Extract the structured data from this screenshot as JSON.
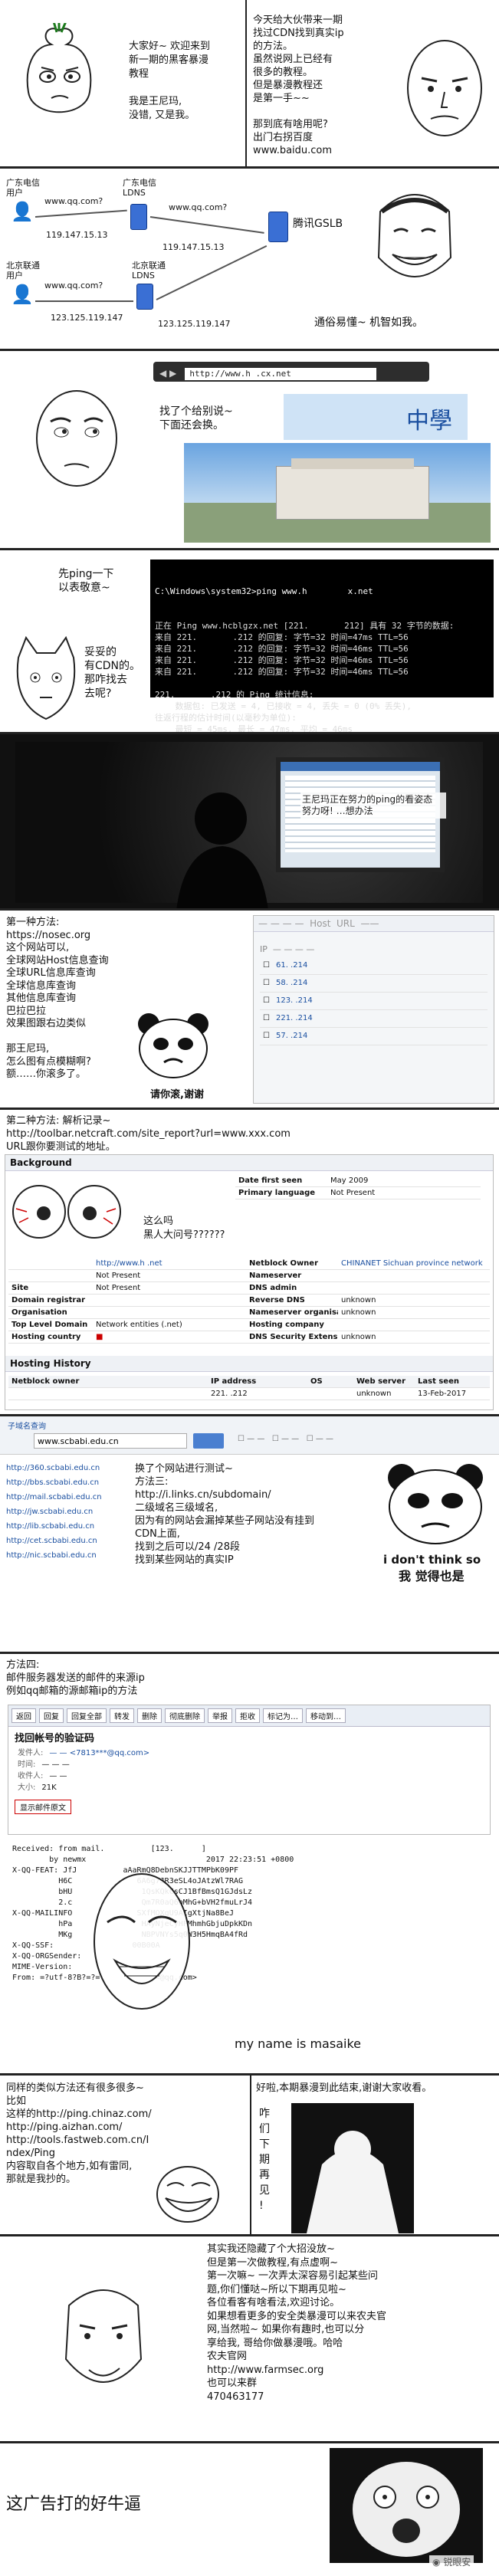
{
  "p1": {
    "bubble_left": "大家好~  欢迎来到\n新一期的黑客暴漫\n教程\n\n我是王尼玛,\n没错, 又是我。",
    "bubble_right": "今天给大伙带来一期\n找过CDN找到真实ip\n的方法。\n虽然说网上已经有\n很多的教程。\n但是暴漫教程还\n是第一手~~\n\n那到底有啥用呢?\n出门右拐百度\nwww.baidu.com"
  },
  "p2": {
    "gd_user": "广东电信\n用户",
    "gd_ldns": "广东电信\nLDNS",
    "bj_user": "北京联通\n用户",
    "bj_ldns": "北京联通\nLDNS",
    "gslb": "腾讯GSLB",
    "query1": "www.qq.com?",
    "query2": "www.qq.com?",
    "ip1": "119.147.15.13",
    "ip2": "119.147.15.13",
    "ip3": "123.125.119.147",
    "ip4": "123.125.119.147",
    "bubble": "通俗易懂~ 机智如我。"
  },
  "p3": {
    "address": "http://www.h           .cx.net",
    "bubble": "找了个给别说~\n下面还会换。",
    "banner": "中學"
  },
  "p4": {
    "bubble_top": "先ping一下\n以表敬意~",
    "bubble_bottom": "妥妥的\n有CDN的。\n那咋找去\n去呢?",
    "cmd_title": "C:\\Windows\\system32>ping www.h        x.net",
    "cmd_lines": [
      "正在 Ping www.hcblgzx.net [221.       212] 具有 32 字节的数据:",
      "来自 221.       .212 的回复: 字节=32 时间=47ms TTL=56",
      "来自 221.       .212 的回复: 字节=32 时间=46ms TTL=56",
      "来自 221.       .212 的回复: 字节=32 时间=46ms TTL=56",
      "来自 221.       .212 的回复: 字节=32 时间=46ms TTL=56",
      "",
      "221.       .212 的 Ping 统计信息:",
      "    数据包: 已发送 = 4, 已接收 = 4, 丢失 = 0 (0% 丢失),",
      "往返行程的估计时间(以毫秒为单位):",
      "    最短 = 45ms, 最长 = 47ms, 平均 = 46ms"
    ]
  },
  "p5": {
    "bubble": "王尼玛正在努力的ping的看姿态\n努力呀!  …想办法"
  },
  "p6": {
    "text": "第一种方法:\nhttps://nosec.org\n这个网站可以,\n全球网站Host信息查询\n全球URL信息库查询\n全球信息库查询\n其他信息库查询\n巴拉巴拉\n效果图跟右边类似\n\n那王尼玛,\n怎么图有点模糊啊?\n额……你滚多了。",
    "panda_caption": "请你滚,谢谢",
    "rows": [
      "61.       .214",
      "58.       .214",
      "123.       .214",
      "221.       .214",
      "57.       .214"
    ]
  },
  "p7": {
    "text": "第二种方法: 解析记录~\nhttp://toolbar.netcraft.com/site_report?url=www.xxx.com\nURL跟你要测试的地址。",
    "bg_title": "Background",
    "bubble": "这么吗\n黑人大问号??????",
    "date_label": "Date first seen",
    "date_value": "May 2009",
    "lang_label": "Primary language",
    "lang_value": "Not Present",
    "site": "http://www.h       .net",
    "owner_label": "Netblock Owner",
    "owner_value": "CHINANET Sichuan province network",
    "ns_label": "Nameserver",
    "dns_label": "DNS admin",
    "rev_label": "Reverse DNS",
    "ns_org_label": "Nameserver organisation",
    "hosting_label": "Hosting company",
    "tld_label": "Top Level Domain",
    "tld_value": "Network entities (.net)",
    "dnssec_label": "DNS Security Extensions",
    "country_label": "Hosting country",
    "history_title": "Hosting History",
    "hist_headers": [
      "Netblock owner",
      "IP address",
      "OS",
      "Web server",
      "Last seen"
    ],
    "hist_row": [
      "",
      "221.       .212",
      "",
      "unknown",
      "13-Feb-2017"
    ],
    "val_unknown": "unknown",
    "val_not_present": "Not Present"
  },
  "p8": {
    "search_value": "www.scbabi.edu.cn",
    "text": "换了个网站进行测试~\n方法三:\nhttp://i.links.cn/subdomain/\n二级域名三级域名,\n因为有的网站会漏掉某些子网站没有挂到\nCDN上面,\n找到之后可以/24 /28段\n找到某些网站的真实IP",
    "dont_think": "i don't think so",
    "dont_think_cn": "我 觉得也是",
    "domains": [
      "http://360.scbabi.edu.cn",
      "http://bbs.scbabi.edu.cn",
      "http://mail.scbabi.edu.cn",
      "http://jw.scbabi.edu.cn",
      "http://lib.scbabi.edu.cn",
      "http://cet.scbabi.edu.cn",
      "http://nic.scbabi.edu.cn"
    ]
  },
  "p9": {
    "text": "方法四:\n邮件服务器发送的邮件的来源ip\n例如qq邮箱的源邮箱ip的方法",
    "toolbar": [
      "返回",
      "回复",
      "回复全部",
      "转发",
      "删除",
      "彻底删除",
      "举报",
      "拒收",
      "标记为…",
      "移动到…"
    ],
    "mail_subject": "找回帐号的验证码",
    "mail_from_label": "发件人:",
    "mail_to_label": "收件人:",
    "mail_time_label": "时间:",
    "mail_size_label": "大小:",
    "mail_size": "21K",
    "show_orig": "显示邮件原文",
    "raw_lines": [
      "Received: from mail.          [123.      ]",
      "        by newmx                          2017 22:23:51 +0800",
      "X-QQ-FEAT: JfJ          aAaRmQ8DebnSKJJTTMPbK09PF",
      "          H6C              6A6g7JR3eSL4oJAtzWl7RAG",
      "          bHU               1QsKQkCsCJ1BfBmsQ1GJdsLz",
      "          2.c               Qm7R0aQ6bMhG+bVH2fmuLrJ4",
      "X-QQ-MAILINFO              SXfMQXgU9AIgXtjNa8BeJ",
      "          hPa               HAyNjeCyHFMhmhGbjuDpkKDn",
      "          MKg               NBPVNYs5q0W3H5HmqBA4fRd",
      "X-QQ-SSF:                 00B00A",
      "X-QQ-ORGSender:",
      "MIME-Version:",
      "From: =?utf-8?B?=?=            <@qq.com>"
    ],
    "caption": "my name is masaike"
  },
  "p10": {
    "text": "同样的类似方法还有很多很多~\n比如\n这样的http://ping.chinaz.com/\nhttp://ping.aizhan.com/\nhttp://tools.fastweb.com.cn/I\nndex/Ping\n内容取自各个地方,如有雷同,\n那就是我抄的。",
    "bubble": "好啦,本期暴漫到此结束,谢谢大家收看。",
    "vertical": "咋\n们\n下\n期\n再\n见\n!"
  },
  "p11": {
    "text": "其实我还隐藏了个大招没放~\n但是第一次做教程,有点虚啊~\n第一次嘛~ 一次弄太深容易引起某些问\n题,你们懂哒~所以下期再见啦~\n各位看客有啥看法,欢迎讨论。\n如果想看更多的安全类暴漫可以来农夫官\n网,当然啦~ 如果你有趣时,也可以分\n享给我,  哥给你做暴漫哦。哈哈\n农夫官网\nhttp://www.farmsec.org\n也可以来群\n470463177"
  },
  "p12": {
    "text": "这广告打的好牛逼",
    "watermark": "锐眼安"
  },
  "colors": {
    "border": "#222222",
    "link_blue": "#1a4fa0",
    "server_blue": "#3a6fd4",
    "console_bg": "#000000"
  }
}
